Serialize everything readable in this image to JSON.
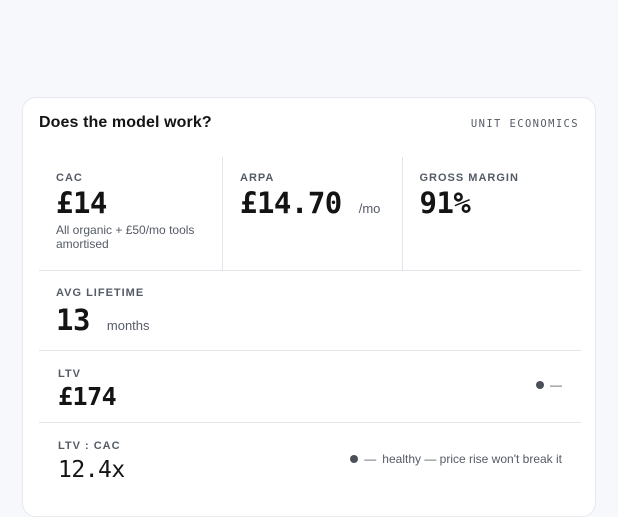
{
  "card": {
    "title": "Does the model work?",
    "tag": "UNIT ECONOMICS"
  },
  "metrics": {
    "cac": {
      "label": "CAC",
      "value": "£14",
      "note": "All organic + £50/mo tools amortised"
    },
    "arpa": {
      "label": "ARPA",
      "value": "£14.70",
      "unit": "/mo"
    },
    "gross_margin": {
      "label": "GROSS MARGIN",
      "value": "91%"
    },
    "avg_lifetime": {
      "label": "AVG LIFETIME",
      "value": "13",
      "unit": "months"
    },
    "ltv": {
      "label": "LTV",
      "value": "£174",
      "status_dash": "—"
    },
    "ltv_cac": {
      "label": "LTV : CAC",
      "value": "12.4x",
      "status_dash": "—",
      "status_text": "healthy — price rise won't break it"
    }
  },
  "colors": {
    "status_dot": "#4b4f57",
    "divider": "#e2e4e9"
  },
  "icons": {
    "status": "status-dot-icon"
  }
}
